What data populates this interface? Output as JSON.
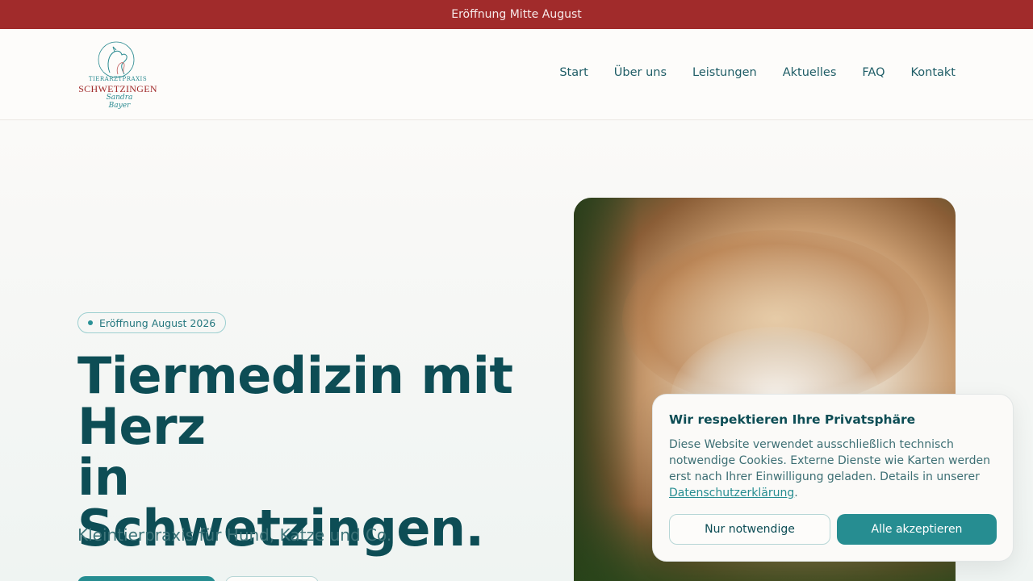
{
  "announcement": {
    "text": "Eröffnung Mitte August"
  },
  "logo": {
    "line1": "TIERARZTPRAXIS",
    "line2": "SCHWETZINGEN",
    "signature": "Sandra Bayer"
  },
  "nav": {
    "items": [
      {
        "label": "Start"
      },
      {
        "label": "Über uns"
      },
      {
        "label": "Leistungen"
      },
      {
        "label": "Aktuelles"
      },
      {
        "label": "FAQ"
      },
      {
        "label": "Kontakt"
      }
    ]
  },
  "hero": {
    "badge": "Eröffnung August 2026",
    "title_line1": "Tiermedizin mit",
    "title_line2": "Herz",
    "title_line3": "in Schwetzingen.",
    "subtitle": "Kleintierpraxis für Hund, Katze und Co."
  },
  "cookie": {
    "title": "Wir respektieren Ihre Privatsphäre",
    "text": "Diese Website verwendet ausschließlich technisch notwendige Cookies. Externe Dienste wie Karten werden erst nach Ihrer Einwilligung geladen. Details in unserer ",
    "link": "Datenschutzerklärung",
    "text_end": ".",
    "decline_label": "Nur notwendige",
    "accept_label": "Alle akzeptieren"
  },
  "colors": {
    "announcement_bg": "#a12b2b",
    "primary": "#268d91",
    "heading": "#0d4d55"
  }
}
